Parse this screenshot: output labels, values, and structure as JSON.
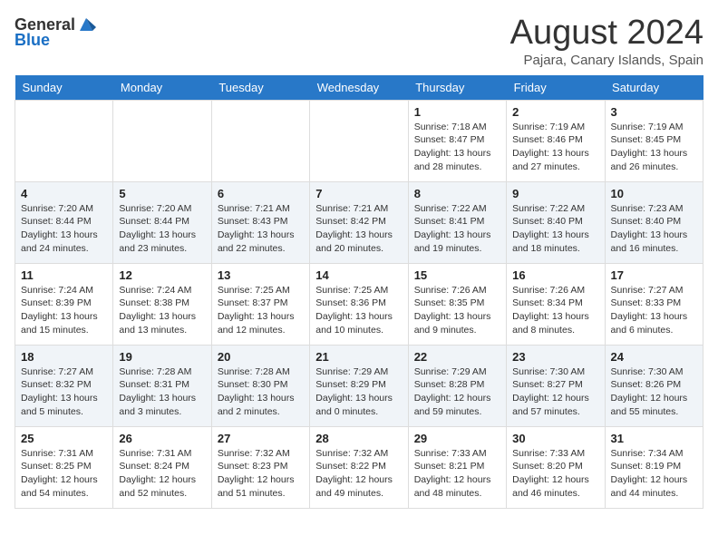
{
  "header": {
    "logo_general": "General",
    "logo_blue": "Blue",
    "month_title": "August 2024",
    "location": "Pajara, Canary Islands, Spain"
  },
  "days_of_week": [
    "Sunday",
    "Monday",
    "Tuesday",
    "Wednesday",
    "Thursday",
    "Friday",
    "Saturday"
  ],
  "weeks": [
    [
      {
        "day": "",
        "info": ""
      },
      {
        "day": "",
        "info": ""
      },
      {
        "day": "",
        "info": ""
      },
      {
        "day": "",
        "info": ""
      },
      {
        "day": "1",
        "info": "Sunrise: 7:18 AM\nSunset: 8:47 PM\nDaylight: 13 hours\nand 28 minutes."
      },
      {
        "day": "2",
        "info": "Sunrise: 7:19 AM\nSunset: 8:46 PM\nDaylight: 13 hours\nand 27 minutes."
      },
      {
        "day": "3",
        "info": "Sunrise: 7:19 AM\nSunset: 8:45 PM\nDaylight: 13 hours\nand 26 minutes."
      }
    ],
    [
      {
        "day": "4",
        "info": "Sunrise: 7:20 AM\nSunset: 8:44 PM\nDaylight: 13 hours\nand 24 minutes."
      },
      {
        "day": "5",
        "info": "Sunrise: 7:20 AM\nSunset: 8:44 PM\nDaylight: 13 hours\nand 23 minutes."
      },
      {
        "day": "6",
        "info": "Sunrise: 7:21 AM\nSunset: 8:43 PM\nDaylight: 13 hours\nand 22 minutes."
      },
      {
        "day": "7",
        "info": "Sunrise: 7:21 AM\nSunset: 8:42 PM\nDaylight: 13 hours\nand 20 minutes."
      },
      {
        "day": "8",
        "info": "Sunrise: 7:22 AM\nSunset: 8:41 PM\nDaylight: 13 hours\nand 19 minutes."
      },
      {
        "day": "9",
        "info": "Sunrise: 7:22 AM\nSunset: 8:40 PM\nDaylight: 13 hours\nand 18 minutes."
      },
      {
        "day": "10",
        "info": "Sunrise: 7:23 AM\nSunset: 8:40 PM\nDaylight: 13 hours\nand 16 minutes."
      }
    ],
    [
      {
        "day": "11",
        "info": "Sunrise: 7:24 AM\nSunset: 8:39 PM\nDaylight: 13 hours\nand 15 minutes."
      },
      {
        "day": "12",
        "info": "Sunrise: 7:24 AM\nSunset: 8:38 PM\nDaylight: 13 hours\nand 13 minutes."
      },
      {
        "day": "13",
        "info": "Sunrise: 7:25 AM\nSunset: 8:37 PM\nDaylight: 13 hours\nand 12 minutes."
      },
      {
        "day": "14",
        "info": "Sunrise: 7:25 AM\nSunset: 8:36 PM\nDaylight: 13 hours\nand 10 minutes."
      },
      {
        "day": "15",
        "info": "Sunrise: 7:26 AM\nSunset: 8:35 PM\nDaylight: 13 hours\nand 9 minutes."
      },
      {
        "day": "16",
        "info": "Sunrise: 7:26 AM\nSunset: 8:34 PM\nDaylight: 13 hours\nand 8 minutes."
      },
      {
        "day": "17",
        "info": "Sunrise: 7:27 AM\nSunset: 8:33 PM\nDaylight: 13 hours\nand 6 minutes."
      }
    ],
    [
      {
        "day": "18",
        "info": "Sunrise: 7:27 AM\nSunset: 8:32 PM\nDaylight: 13 hours\nand 5 minutes."
      },
      {
        "day": "19",
        "info": "Sunrise: 7:28 AM\nSunset: 8:31 PM\nDaylight: 13 hours\nand 3 minutes."
      },
      {
        "day": "20",
        "info": "Sunrise: 7:28 AM\nSunset: 8:30 PM\nDaylight: 13 hours\nand 2 minutes."
      },
      {
        "day": "21",
        "info": "Sunrise: 7:29 AM\nSunset: 8:29 PM\nDaylight: 13 hours\nand 0 minutes."
      },
      {
        "day": "22",
        "info": "Sunrise: 7:29 AM\nSunset: 8:28 PM\nDaylight: 12 hours\nand 59 minutes."
      },
      {
        "day": "23",
        "info": "Sunrise: 7:30 AM\nSunset: 8:27 PM\nDaylight: 12 hours\nand 57 minutes."
      },
      {
        "day": "24",
        "info": "Sunrise: 7:30 AM\nSunset: 8:26 PM\nDaylight: 12 hours\nand 55 minutes."
      }
    ],
    [
      {
        "day": "25",
        "info": "Sunrise: 7:31 AM\nSunset: 8:25 PM\nDaylight: 12 hours\nand 54 minutes."
      },
      {
        "day": "26",
        "info": "Sunrise: 7:31 AM\nSunset: 8:24 PM\nDaylight: 12 hours\nand 52 minutes."
      },
      {
        "day": "27",
        "info": "Sunrise: 7:32 AM\nSunset: 8:23 PM\nDaylight: 12 hours\nand 51 minutes."
      },
      {
        "day": "28",
        "info": "Sunrise: 7:32 AM\nSunset: 8:22 PM\nDaylight: 12 hours\nand 49 minutes."
      },
      {
        "day": "29",
        "info": "Sunrise: 7:33 AM\nSunset: 8:21 PM\nDaylight: 12 hours\nand 48 minutes."
      },
      {
        "day": "30",
        "info": "Sunrise: 7:33 AM\nSunset: 8:20 PM\nDaylight: 12 hours\nand 46 minutes."
      },
      {
        "day": "31",
        "info": "Sunrise: 7:34 AM\nSunset: 8:19 PM\nDaylight: 12 hours\nand 44 minutes."
      }
    ]
  ]
}
